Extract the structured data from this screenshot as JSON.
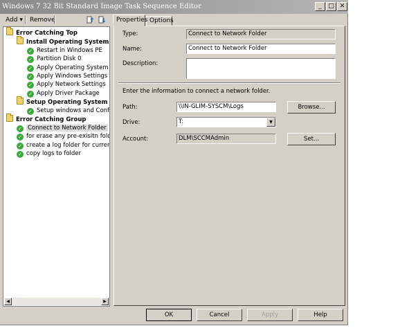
{
  "window": {
    "title": "Windows 7 32 Bit Standard Image Task Sequence Editor"
  },
  "titlebar_buttons": [
    "_",
    "□",
    "✕"
  ],
  "toolbar": {
    "add_label": "Add",
    "add_arrow": "▾",
    "remove_label": "Remove"
  },
  "tree": {
    "items": [
      {
        "label": "Error Catching Top",
        "type": "group"
      },
      {
        "label": "Install Operating System",
        "type": "group"
      },
      {
        "label": "Restart in Windows PE",
        "type": "step"
      },
      {
        "label": "Partition Disk 0",
        "type": "step"
      },
      {
        "label": "Apply Operating System",
        "type": "step"
      },
      {
        "label": "Apply Windows Settings",
        "type": "step"
      },
      {
        "label": "Apply Network Settings",
        "type": "step"
      },
      {
        "label": "Apply Driver Package",
        "type": "step"
      },
      {
        "label": "Setup Operating System",
        "type": "group"
      },
      {
        "label": "Setup windows and Configu",
        "type": "step"
      },
      {
        "label": "Error Catching Group",
        "type": "group"
      },
      {
        "label": "Connect to Network Folder",
        "type": "step",
        "selected": true
      },
      {
        "label": "for erase any pre-exisitn folder",
        "type": "step"
      },
      {
        "label": "create a log folder for current m",
        "type": "step"
      },
      {
        "label": "copy logs to folder",
        "type": "step"
      }
    ]
  },
  "tabs": {
    "properties": "Properties",
    "options": "Options"
  },
  "properties": {
    "type_label": "Type:",
    "type_value": "Connect to Network Folder",
    "name_label": "Name:",
    "name_value": "Connect to Network Folder",
    "description_label": "Description:",
    "description_value": "",
    "info_text": "Enter the information to connect a network folder.",
    "path_label": "Path:",
    "path_value": "\\\\IN-GLIM-SYSCM\\Logs",
    "browse_label": "Browse...",
    "drive_label": "Drive:",
    "drive_value": "T:",
    "account_label": "Account:",
    "account_value": "DLM\\SCCMAdmin",
    "set_label": "Set..."
  },
  "footer": {
    "ok": "OK",
    "cancel": "Cancel",
    "apply": "Apply",
    "help": "Help"
  }
}
